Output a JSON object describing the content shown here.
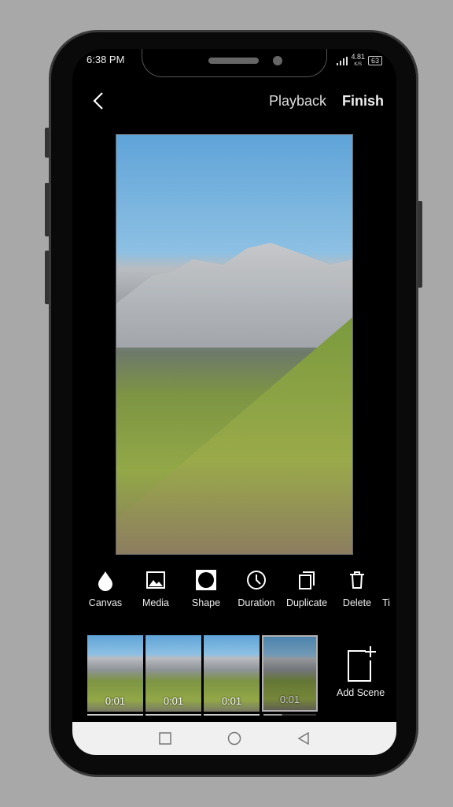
{
  "status": {
    "time": "6:38 PM",
    "speed": "4.81",
    "speed_unit": "K/S",
    "battery": "63"
  },
  "header": {
    "back_icon": "chevron-left-icon",
    "playback": "Playback",
    "finish": "Finish"
  },
  "tools": [
    {
      "label": "Canvas",
      "icon": "drop-icon"
    },
    {
      "label": "Media",
      "icon": "image-icon"
    },
    {
      "label": "Shape",
      "icon": "shape-icon"
    },
    {
      "label": "Duration",
      "icon": "clock-icon"
    },
    {
      "label": "Duplicate",
      "icon": "duplicate-icon"
    },
    {
      "label": "Delete",
      "icon": "trash-icon"
    },
    {
      "label": "Ti"
    }
  ],
  "scenes": [
    {
      "duration": "0:01",
      "progress": 1
    },
    {
      "duration": "0:01",
      "progress": 1
    },
    {
      "duration": "0:01",
      "progress": 1
    },
    {
      "duration": "0:01",
      "progress": 0.35,
      "selected": true
    }
  ],
  "add_scene": "Add Scene"
}
